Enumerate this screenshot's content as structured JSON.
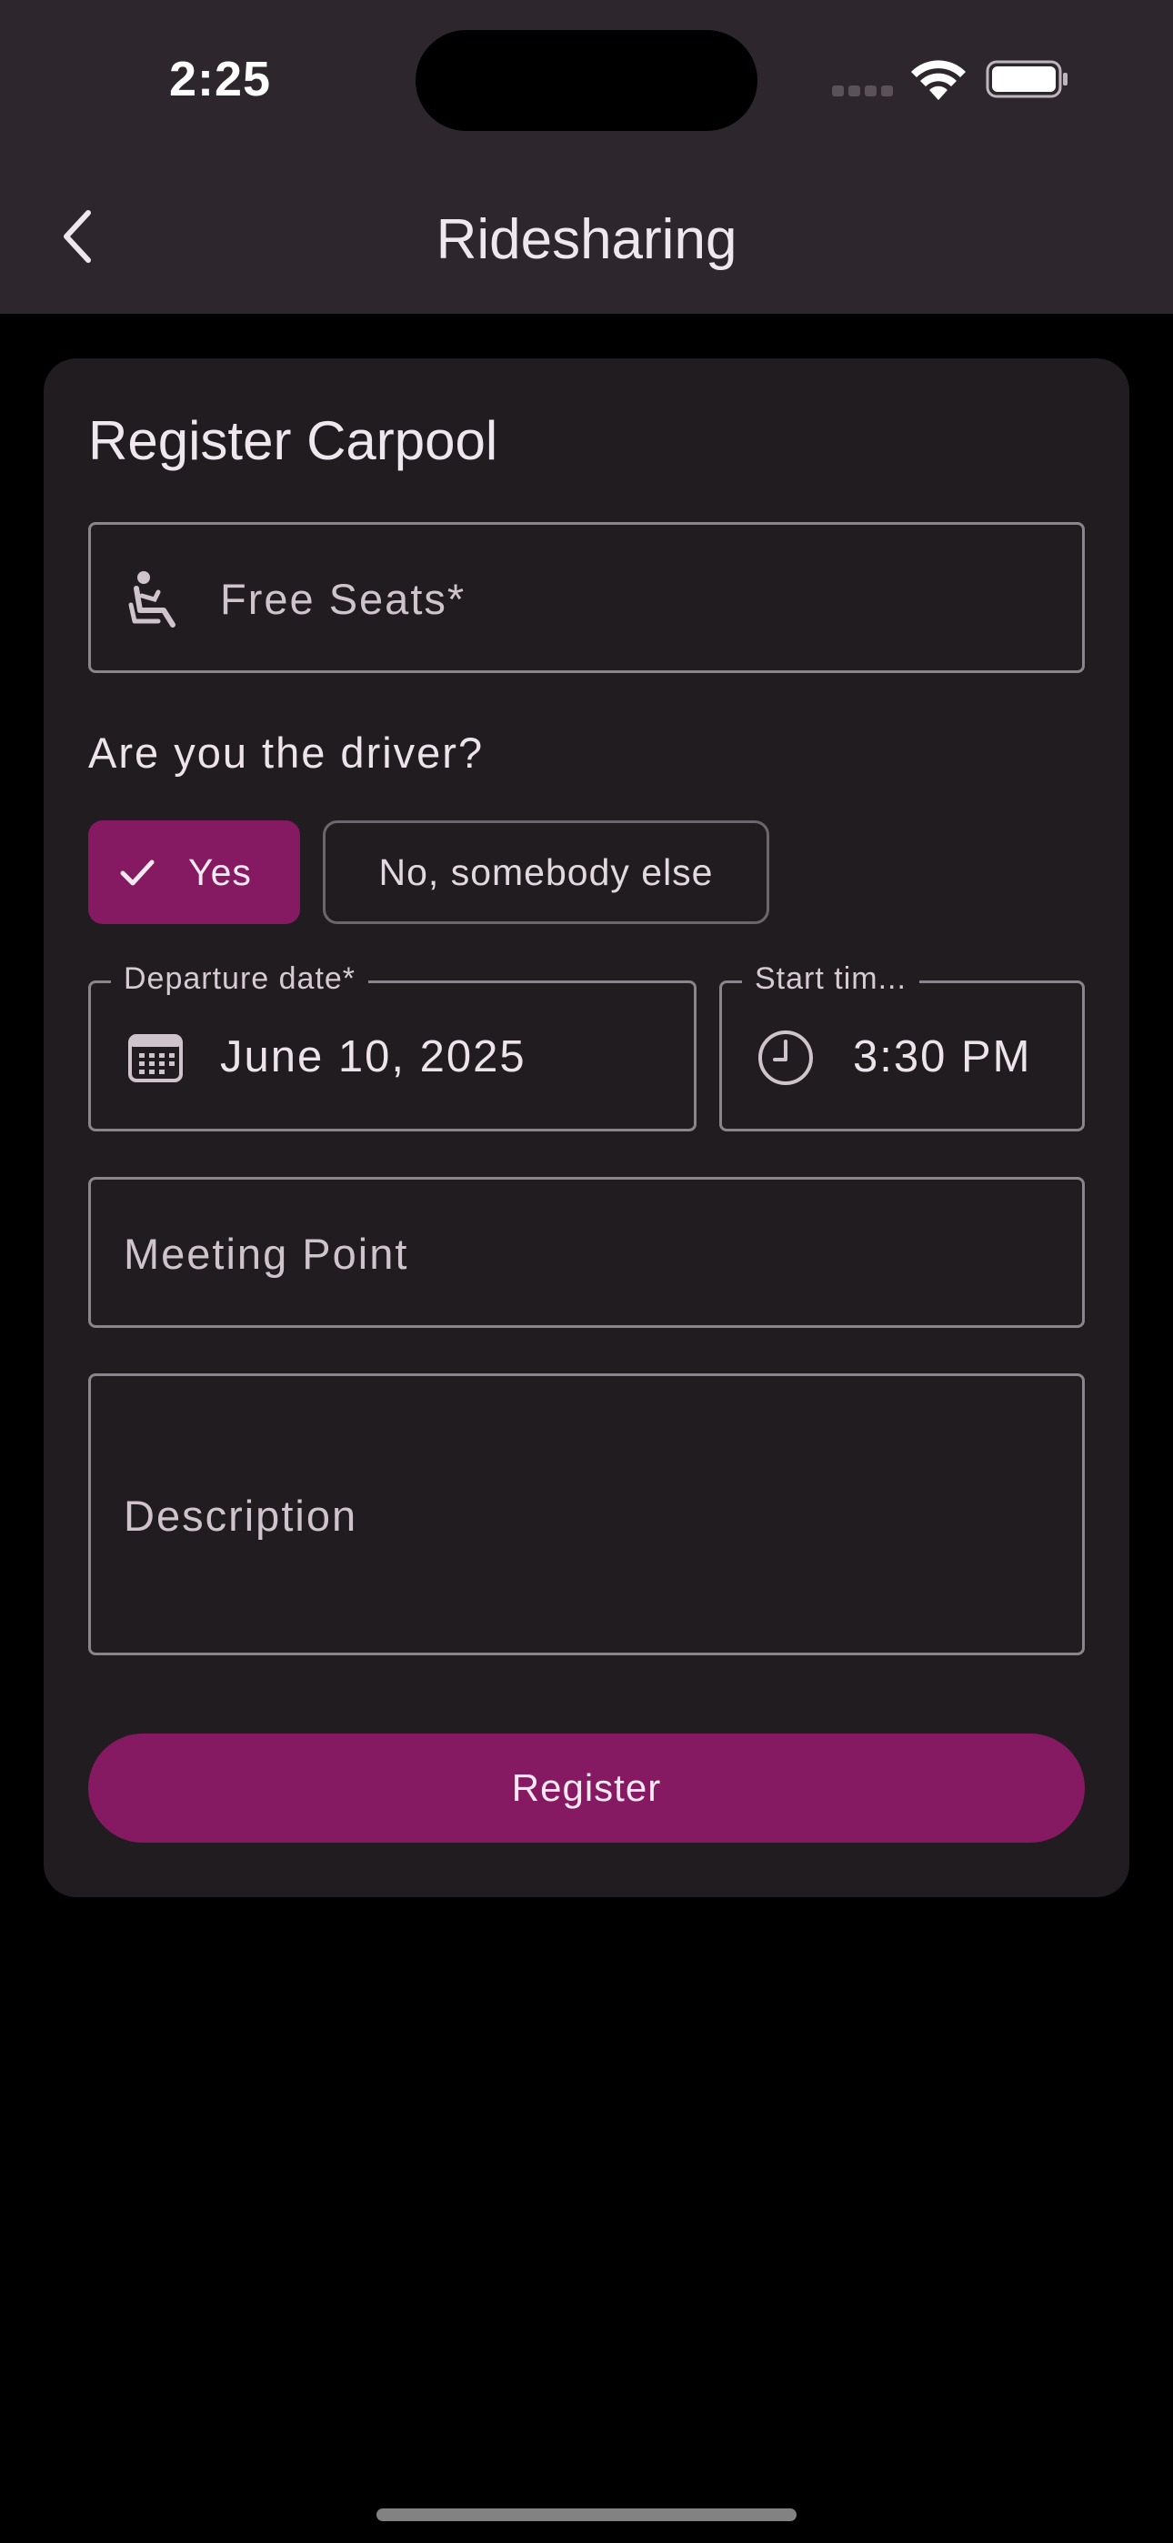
{
  "status_bar": {
    "time": "2:25"
  },
  "app_bar": {
    "title": "Ridesharing",
    "back_icon": "chevron-left-icon"
  },
  "form": {
    "title": "Register Carpool",
    "free_seats": {
      "placeholder": "Free Seats*",
      "value": "",
      "icon": "seat-icon"
    },
    "driver_question": "Are you the driver?",
    "driver_options": [
      {
        "label": "Yes",
        "selected": true
      },
      {
        "label": "No, somebody else",
        "selected": false
      }
    ],
    "departure_date": {
      "label": "Departure date*",
      "value": "June 10, 2025",
      "icon": "calendar-icon"
    },
    "start_time": {
      "label": "Start tim...",
      "value": "3:30 PM",
      "icon": "clock-icon"
    },
    "meeting_point": {
      "placeholder": "Meeting Point",
      "value": ""
    },
    "description": {
      "placeholder": "Description",
      "value": ""
    },
    "submit_label": "Register"
  },
  "colors": {
    "accent": "#861a62",
    "app_bar_bg": "#2e262d",
    "card_bg": "#201c1f",
    "page_bg": "#000000"
  }
}
